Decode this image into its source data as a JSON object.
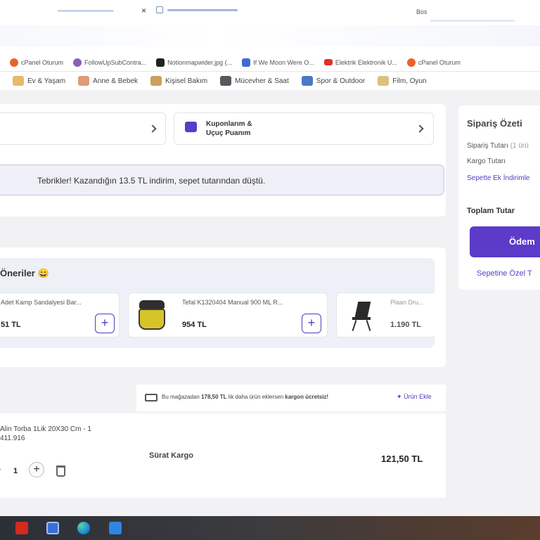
{
  "browser": {
    "tab_short_label": "Bos",
    "close_glyph": "×"
  },
  "bookmarks": [
    {
      "label": "cPanel Oturum",
      "color": "#e8632b"
    },
    {
      "label": "FollowUpSubContra...",
      "color": "#8e5db5"
    },
    {
      "label": "Notionmapwider.jpg (...",
      "color": "#222222"
    },
    {
      "label": "If We Moon Were O...",
      "color": "#3e6bd6"
    },
    {
      "label": "Elektrik Elektronik U...",
      "color": "#e52d27"
    },
    {
      "label": "cPanel Oturum",
      "color": "#e8632b"
    }
  ],
  "categories": [
    {
      "label": "Ev & Yaşam",
      "color": "#e9b86a"
    },
    {
      "label": "Anne & Bebek",
      "color": "#e09c7a"
    },
    {
      "label": "Kişisel Bakım",
      "color": "#c9a15d"
    },
    {
      "label": "Mücevher & Saat",
      "color": "#55585e"
    },
    {
      "label": "Spor & Outdoor",
      "color": "#4c78c8"
    },
    {
      "label": "Film, Oyun",
      "color": "#d9c27c"
    }
  ],
  "coupons": {
    "title_line1": "Kuponlarım &",
    "title_line2": "Uçuç Puanım"
  },
  "congrats_banner": "Tebrikler! Kazandığın 13.5 TL indirim, sepet tutarından düştü.",
  "suggestions": {
    "title": "Öneriler",
    "emoji": "😄",
    "items": [
      {
        "name": "Adet Kamp Sandalyesi Bar...",
        "price": "51 TL"
      },
      {
        "name": "Tefal K1320404 Manual 900 ML R...",
        "price": "954 TL"
      },
      {
        "name": "Plaan Dru...",
        "price": "1.190 TL"
      }
    ],
    "add_glyph": "+"
  },
  "shipping_notice": {
    "prefix": "Bu mağazadan",
    "amount": "178,50 TL",
    "middle": "lik daha ürün eklersen",
    "bold_end": "kargon ücretsiz!",
    "add_link": "Ürün Ekle"
  },
  "cart_item": {
    "name_line1": "Alin Torba 1Lik 20X30 Cm - 1",
    "name_line2": "411.916",
    "quantity": "1",
    "shipper": "Sürat Kargo",
    "price": "121,50 TL",
    "minus_glyph": "−",
    "plus_glyph": "+"
  },
  "summary": {
    "title": "Sipariş Özeti",
    "order_total_label": "Sipariş Tutarı",
    "order_total_note": "(1 ürü",
    "shipping_label": "Kargo Tutarı",
    "cart_discount_link": "Sepette Ek İndirimle",
    "total_label": "Toplam Tutar",
    "pay_button": "Ödem",
    "special_link": "Sepetine Özel T"
  },
  "colors": {
    "brand": "#5b3bc8",
    "banner_bg": "#efeff8",
    "banner_border": "#c5c7d8",
    "suggestions_bg": "#eef0f8"
  }
}
